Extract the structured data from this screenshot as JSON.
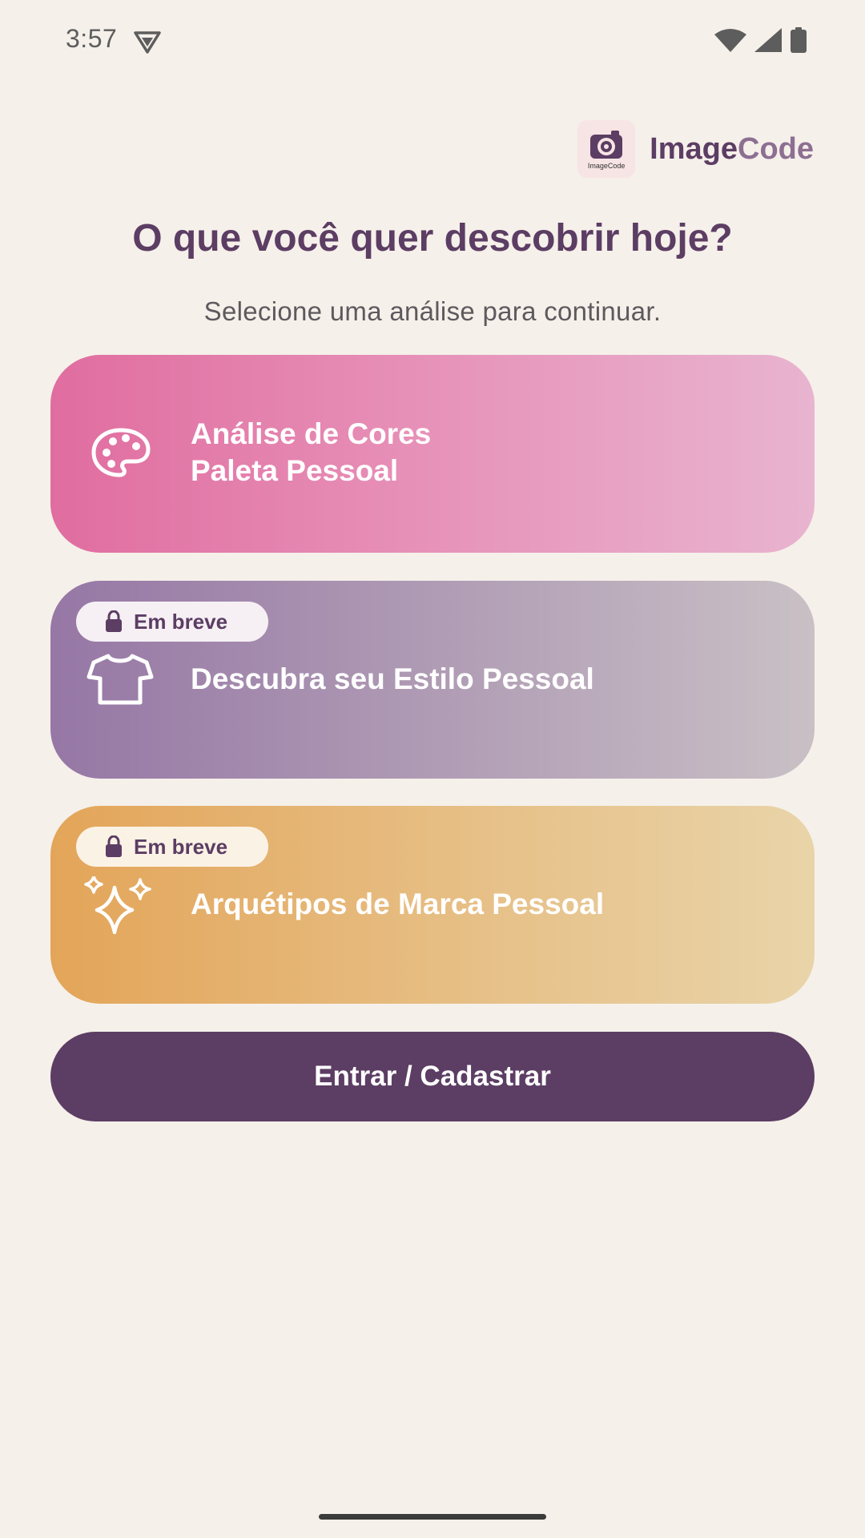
{
  "status_bar": {
    "time": "3:57",
    "icons": [
      "vpn-icon",
      "wifi-icon",
      "signal-icon",
      "battery-icon"
    ]
  },
  "brand": {
    "logo_caption": "ImageCode",
    "name_part1": "Image",
    "name_part2": "Code"
  },
  "header": {
    "title": "O que você quer descobrir hoje?",
    "subtitle": "Selecione uma análise para continuar."
  },
  "cards": [
    {
      "icon": "palette-icon",
      "label_line1": "Análise de Cores",
      "label_line2": "Paleta Pessoal",
      "badge": null
    },
    {
      "icon": "tshirt-icon",
      "label_line1": "Descubra seu Estilo Pessoal",
      "badge": "Em breve"
    },
    {
      "icon": "sparkles-icon",
      "label_line1": "Arquétipos de Marca Pessoal",
      "badge": "Em breve"
    }
  ],
  "cta": {
    "label": "Entrar / Cadastrar"
  },
  "colors": {
    "background": "#f5f0ea",
    "primary": "#5c3d63",
    "card_pink": "#e06d9f",
    "card_purple": "#9677a5",
    "card_orange": "#e3a559"
  }
}
